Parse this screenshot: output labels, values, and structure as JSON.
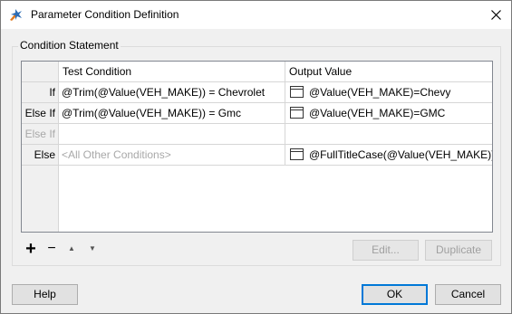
{
  "window": {
    "title": "Parameter Condition Definition"
  },
  "group": {
    "label": "Condition Statement"
  },
  "grid": {
    "headers": {
      "test": "Test Condition",
      "output": "Output Value"
    },
    "rows": [
      {
        "label": "If",
        "test": "@Trim(@Value(VEH_MAKE)) = Chevrolet",
        "output": "@Value(VEH_MAKE)=Chevy"
      },
      {
        "label": "Else If",
        "test": "@Trim(@Value(VEH_MAKE)) = Gmc",
        "output": "@Value(VEH_MAKE)=GMC"
      },
      {
        "label": "Else If",
        "test": "",
        "output": ""
      },
      {
        "label": "Else",
        "test": "<All Other Conditions>",
        "output": "@FullTitleCase(@Value(VEH_MAKE))"
      }
    ]
  },
  "toolbar": {
    "add": "+",
    "remove": "−",
    "up": "▲",
    "down": "▼",
    "edit": "Edit...",
    "duplicate": "Duplicate"
  },
  "footer": {
    "help": "Help",
    "ok": "OK",
    "cancel": "Cancel"
  },
  "colors": {
    "accent": "#0078d7",
    "disabled_text": "#a8a8a8"
  }
}
